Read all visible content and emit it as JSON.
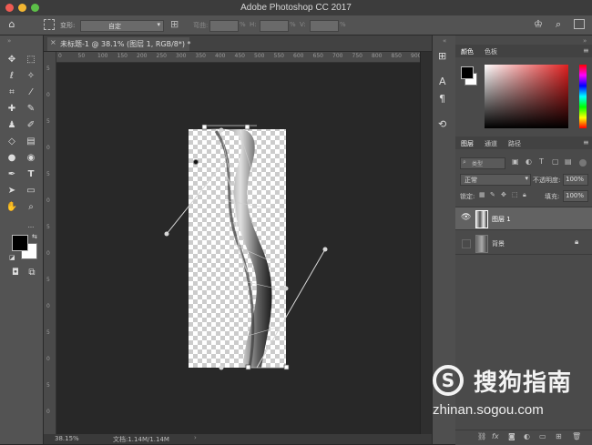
{
  "app": {
    "title": "Adobe Photoshop CC 2017"
  },
  "options_bar": {
    "transform_label": "变形:",
    "transform_value": "自定",
    "h_label": "弯曲:",
    "percent": "%",
    "v_label": "H:",
    "w_label": "V:"
  },
  "document": {
    "tab_title": "未标题-1 @ 38.1% (图层 1, RGB/8*) *",
    "zoom": "38.15%",
    "doc_info": "文档:1.14M/1.14M"
  },
  "rulers": {
    "horizontal": [
      "0",
      "50",
      "100",
      "150",
      "200",
      "250",
      "300",
      "350",
      "400",
      "450",
      "500",
      "550",
      "600",
      "650",
      "700",
      "750",
      "800",
      "850",
      "900"
    ],
    "vertical": [
      "5",
      "0",
      "5",
      "0",
      "5",
      "0",
      "5",
      "0",
      "5",
      "0",
      "5",
      "0",
      "5",
      "0"
    ]
  },
  "panels": {
    "color_tabs": [
      "颜色",
      "色板"
    ],
    "layers_tabs": [
      "图层",
      "通道",
      "路径"
    ],
    "kind_label": "类型",
    "blend_mode": "正常",
    "opacity_label": "不透明度:",
    "opacity_value": "100%",
    "lock_label": "锁定:",
    "fill_label": "填充:",
    "fill_value": "100%",
    "layers": [
      {
        "name": "图层 1",
        "selected": true
      },
      {
        "name": "背景",
        "selected": false
      }
    ]
  },
  "watermark": {
    "name": "搜狗指南",
    "url": "zhinan.sogou.com"
  },
  "colors": {
    "foreground": "#000000",
    "background": "#ffffff",
    "hue_top": "#ff0000"
  }
}
